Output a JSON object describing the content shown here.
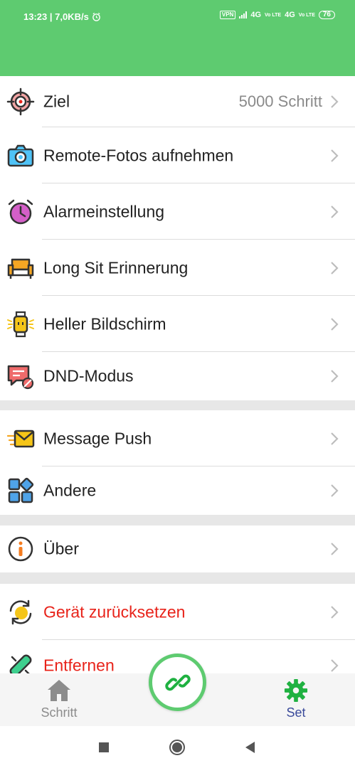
{
  "status_bar": {
    "time_speed": "13:23 | 7,0KB/s",
    "vpn": "VPN",
    "net1": "4G",
    "net2": "4G",
    "volte": "Vo LTE",
    "battery": "76"
  },
  "colors": {
    "accent_green": "#5ecb70",
    "danger_red": "#e8231a",
    "divider_gray": "#e7e7e7"
  },
  "settings": {
    "goal": {
      "label": "Ziel",
      "value": "5000 Schritt",
      "icon": "target-icon"
    },
    "remote_photo": {
      "label": "Remote-Fotos aufnehmen",
      "icon": "camera-icon"
    },
    "alarm": {
      "label": "Alarmeinstellung",
      "icon": "alarm-clock-icon"
    },
    "long_sit": {
      "label": "Long Sit Erinnerung",
      "icon": "armchair-icon"
    },
    "bright_screen": {
      "label": "Heller Bildschirm",
      "icon": "smartwatch-icon"
    },
    "dnd": {
      "label": "DND-Modus",
      "icon": "do-not-disturb-icon"
    },
    "message_push": {
      "label": "Message Push",
      "icon": "envelope-icon"
    },
    "other": {
      "label": "Andere",
      "icon": "apps-grid-icon"
    },
    "about": {
      "label": "Über",
      "icon": "info-icon"
    },
    "reset": {
      "label": "Gerät zurücksetzen",
      "icon": "reset-icon"
    },
    "remove": {
      "label": "Entfernen",
      "icon": "unlink-icon"
    }
  },
  "bottom_nav": {
    "steps_label": "Schritt",
    "set_label": "Set",
    "connect_icon": "link-icon"
  }
}
